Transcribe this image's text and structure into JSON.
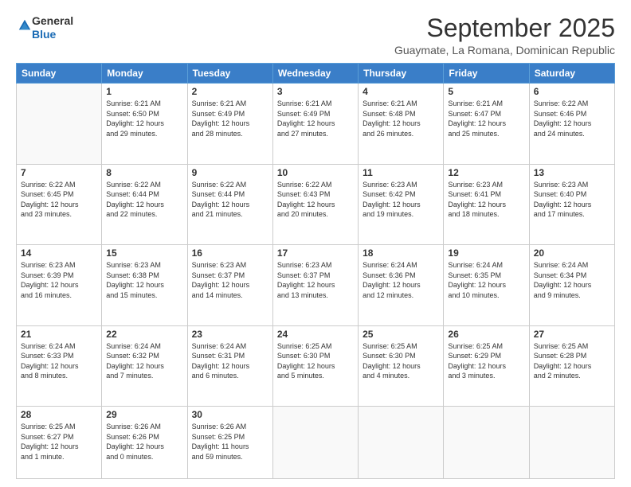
{
  "logo": {
    "general": "General",
    "blue": "Blue"
  },
  "header": {
    "month": "September 2025",
    "location": "Guaymate, La Romana, Dominican Republic"
  },
  "weekdays": [
    "Sunday",
    "Monday",
    "Tuesday",
    "Wednesday",
    "Thursday",
    "Friday",
    "Saturday"
  ],
  "weeks": [
    [
      {
        "day": "",
        "lines": []
      },
      {
        "day": "1",
        "lines": [
          "Sunrise: 6:21 AM",
          "Sunset: 6:50 PM",
          "Daylight: 12 hours",
          "and 29 minutes."
        ]
      },
      {
        "day": "2",
        "lines": [
          "Sunrise: 6:21 AM",
          "Sunset: 6:49 PM",
          "Daylight: 12 hours",
          "and 28 minutes."
        ]
      },
      {
        "day": "3",
        "lines": [
          "Sunrise: 6:21 AM",
          "Sunset: 6:49 PM",
          "Daylight: 12 hours",
          "and 27 minutes."
        ]
      },
      {
        "day": "4",
        "lines": [
          "Sunrise: 6:21 AM",
          "Sunset: 6:48 PM",
          "Daylight: 12 hours",
          "and 26 minutes."
        ]
      },
      {
        "day": "5",
        "lines": [
          "Sunrise: 6:21 AM",
          "Sunset: 6:47 PM",
          "Daylight: 12 hours",
          "and 25 minutes."
        ]
      },
      {
        "day": "6",
        "lines": [
          "Sunrise: 6:22 AM",
          "Sunset: 6:46 PM",
          "Daylight: 12 hours",
          "and 24 minutes."
        ]
      }
    ],
    [
      {
        "day": "7",
        "lines": [
          "Sunrise: 6:22 AM",
          "Sunset: 6:45 PM",
          "Daylight: 12 hours",
          "and 23 minutes."
        ]
      },
      {
        "day": "8",
        "lines": [
          "Sunrise: 6:22 AM",
          "Sunset: 6:44 PM",
          "Daylight: 12 hours",
          "and 22 minutes."
        ]
      },
      {
        "day": "9",
        "lines": [
          "Sunrise: 6:22 AM",
          "Sunset: 6:44 PM",
          "Daylight: 12 hours",
          "and 21 minutes."
        ]
      },
      {
        "day": "10",
        "lines": [
          "Sunrise: 6:22 AM",
          "Sunset: 6:43 PM",
          "Daylight: 12 hours",
          "and 20 minutes."
        ]
      },
      {
        "day": "11",
        "lines": [
          "Sunrise: 6:23 AM",
          "Sunset: 6:42 PM",
          "Daylight: 12 hours",
          "and 19 minutes."
        ]
      },
      {
        "day": "12",
        "lines": [
          "Sunrise: 6:23 AM",
          "Sunset: 6:41 PM",
          "Daylight: 12 hours",
          "and 18 minutes."
        ]
      },
      {
        "day": "13",
        "lines": [
          "Sunrise: 6:23 AM",
          "Sunset: 6:40 PM",
          "Daylight: 12 hours",
          "and 17 minutes."
        ]
      }
    ],
    [
      {
        "day": "14",
        "lines": [
          "Sunrise: 6:23 AM",
          "Sunset: 6:39 PM",
          "Daylight: 12 hours",
          "and 16 minutes."
        ]
      },
      {
        "day": "15",
        "lines": [
          "Sunrise: 6:23 AM",
          "Sunset: 6:38 PM",
          "Daylight: 12 hours",
          "and 15 minutes."
        ]
      },
      {
        "day": "16",
        "lines": [
          "Sunrise: 6:23 AM",
          "Sunset: 6:37 PM",
          "Daylight: 12 hours",
          "and 14 minutes."
        ]
      },
      {
        "day": "17",
        "lines": [
          "Sunrise: 6:23 AM",
          "Sunset: 6:37 PM",
          "Daylight: 12 hours",
          "and 13 minutes."
        ]
      },
      {
        "day": "18",
        "lines": [
          "Sunrise: 6:24 AM",
          "Sunset: 6:36 PM",
          "Daylight: 12 hours",
          "and 12 minutes."
        ]
      },
      {
        "day": "19",
        "lines": [
          "Sunrise: 6:24 AM",
          "Sunset: 6:35 PM",
          "Daylight: 12 hours",
          "and 10 minutes."
        ]
      },
      {
        "day": "20",
        "lines": [
          "Sunrise: 6:24 AM",
          "Sunset: 6:34 PM",
          "Daylight: 12 hours",
          "and 9 minutes."
        ]
      }
    ],
    [
      {
        "day": "21",
        "lines": [
          "Sunrise: 6:24 AM",
          "Sunset: 6:33 PM",
          "Daylight: 12 hours",
          "and 8 minutes."
        ]
      },
      {
        "day": "22",
        "lines": [
          "Sunrise: 6:24 AM",
          "Sunset: 6:32 PM",
          "Daylight: 12 hours",
          "and 7 minutes."
        ]
      },
      {
        "day": "23",
        "lines": [
          "Sunrise: 6:24 AM",
          "Sunset: 6:31 PM",
          "Daylight: 12 hours",
          "and 6 minutes."
        ]
      },
      {
        "day": "24",
        "lines": [
          "Sunrise: 6:25 AM",
          "Sunset: 6:30 PM",
          "Daylight: 12 hours",
          "and 5 minutes."
        ]
      },
      {
        "day": "25",
        "lines": [
          "Sunrise: 6:25 AM",
          "Sunset: 6:30 PM",
          "Daylight: 12 hours",
          "and 4 minutes."
        ]
      },
      {
        "day": "26",
        "lines": [
          "Sunrise: 6:25 AM",
          "Sunset: 6:29 PM",
          "Daylight: 12 hours",
          "and 3 minutes."
        ]
      },
      {
        "day": "27",
        "lines": [
          "Sunrise: 6:25 AM",
          "Sunset: 6:28 PM",
          "Daylight: 12 hours",
          "and 2 minutes."
        ]
      }
    ],
    [
      {
        "day": "28",
        "lines": [
          "Sunrise: 6:25 AM",
          "Sunset: 6:27 PM",
          "Daylight: 12 hours",
          "and 1 minute."
        ]
      },
      {
        "day": "29",
        "lines": [
          "Sunrise: 6:26 AM",
          "Sunset: 6:26 PM",
          "Daylight: 12 hours",
          "and 0 minutes."
        ]
      },
      {
        "day": "30",
        "lines": [
          "Sunrise: 6:26 AM",
          "Sunset: 6:25 PM",
          "Daylight: 11 hours",
          "and 59 minutes."
        ]
      },
      {
        "day": "",
        "lines": []
      },
      {
        "day": "",
        "lines": []
      },
      {
        "day": "",
        "lines": []
      },
      {
        "day": "",
        "lines": []
      }
    ]
  ]
}
